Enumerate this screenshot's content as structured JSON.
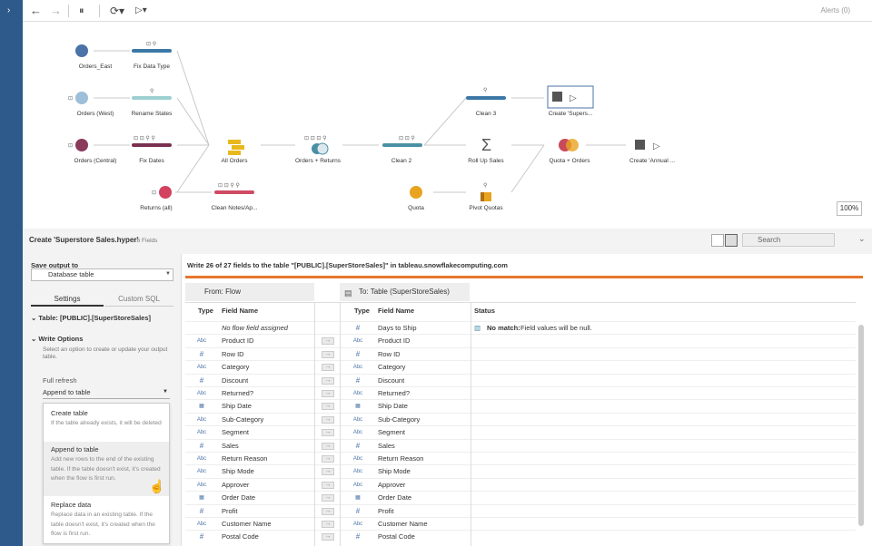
{
  "toolbar": {
    "alerts": "Alerts (0)"
  },
  "nodes": [
    {
      "id": "orders-east",
      "label": "Orders_East"
    },
    {
      "id": "fix-data-type",
      "label": "Fix Data Type"
    },
    {
      "id": "orders-west",
      "label": "Orders (West)"
    },
    {
      "id": "rename-states",
      "label": "Rename States"
    },
    {
      "id": "orders-central",
      "label": "Orders (Central)"
    },
    {
      "id": "fix-dates",
      "label": "Fix Dates"
    },
    {
      "id": "all-orders",
      "label": "All Orders"
    },
    {
      "id": "orders-returns",
      "label": "Orders + Returns"
    },
    {
      "id": "clean-2",
      "label": "Clean 2"
    },
    {
      "id": "returns-all",
      "label": "Returns (all)"
    },
    {
      "id": "clean-notes",
      "label": "Clean Notes/Ap..."
    },
    {
      "id": "clean-3",
      "label": "Clean 3"
    },
    {
      "id": "create-superstore",
      "label": "Create 'Supers..."
    },
    {
      "id": "roll-up-sales",
      "label": "Roll Up Sales"
    },
    {
      "id": "quota-orders",
      "label": "Quota + Orders"
    },
    {
      "id": "create-annual",
      "label": "Create 'Annual ..."
    },
    {
      "id": "quota",
      "label": "Quota"
    },
    {
      "id": "pivot-quotas",
      "label": "Pivot Quotas"
    }
  ],
  "canvas": {
    "zoom": "100%"
  },
  "panel": {
    "title": "Create 'Superstore Sales.hyper'",
    "fields_count": "26 Fields",
    "search_placeholder": "Search"
  },
  "left": {
    "save_output_label": "Save output to",
    "save_output_value": "Database table",
    "tabs": {
      "settings": "Settings",
      "custom_sql": "Custom SQL"
    },
    "table_label": "Table: [PUBLIC].[SuperStoreSales]",
    "write_options_label": "Write Options",
    "write_options_desc": "Select an option to create or update your output table.",
    "full_refresh": "Full refresh",
    "selected": "Append to table",
    "options": [
      {
        "title": "Create table",
        "desc": "If the table already exists, it will be deleted"
      },
      {
        "title": "Append to table",
        "desc": "Add new rows to the end of the existing table. If the table doesn't exist, it's created when the flow is first run."
      },
      {
        "title": "Replace data",
        "desc": "Replace data in an existing table. If the table doesn't exist, it's created when the flow is first run."
      }
    ]
  },
  "right": {
    "write_msg": "Write 26 of 27 fields to the table \"[PUBLIC].[SuperStoreSales]\" in tableau.snowflakecomputing.com",
    "from_header": "From: Flow",
    "to_header": "To: Table (SuperStoreSales)",
    "col_type": "Type",
    "col_field": "Field Name",
    "col_status": "Status",
    "rows": [
      {
        "from_type": "",
        "from": "No flow field assigned",
        "to_type": "#",
        "to": "Days to Ship",
        "status_bold": "No match:",
        "status": "Field values will be null."
      },
      {
        "from_type": "Abc",
        "from": "Product ID",
        "to_type": "Abc",
        "to": "Product ID"
      },
      {
        "from_type": "#",
        "from": "Row ID",
        "to_type": "#",
        "to": "Row ID"
      },
      {
        "from_type": "Abc",
        "from": "Category",
        "to_type": "Abc",
        "to": "Category"
      },
      {
        "from_type": "#",
        "from": "Discount",
        "to_type": "#",
        "to": "Discount"
      },
      {
        "from_type": "Abc",
        "from": "Returned?",
        "to_type": "Abc",
        "to": "Returned?"
      },
      {
        "from_type": "cal",
        "from": "Ship Date",
        "to_type": "cal",
        "to": "Ship Date"
      },
      {
        "from_type": "Abc",
        "from": "Sub-Category",
        "to_type": "Abc",
        "to": "Sub-Category"
      },
      {
        "from_type": "Abc",
        "from": "Segment",
        "to_type": "Abc",
        "to": "Segment"
      },
      {
        "from_type": "#",
        "from": "Sales",
        "to_type": "#",
        "to": "Sales"
      },
      {
        "from_type": "Abc",
        "from": "Return Reason",
        "to_type": "Abc",
        "to": "Return Reason"
      },
      {
        "from_type": "Abc",
        "from": "Ship Mode",
        "to_type": "Abc",
        "to": "Ship Mode"
      },
      {
        "from_type": "Abc",
        "from": "Approver",
        "to_type": "Abc",
        "to": "Approver"
      },
      {
        "from_type": "cal",
        "from": "Order Date",
        "to_type": "cal",
        "to": "Order Date"
      },
      {
        "from_type": "#",
        "from": "Profit",
        "to_type": "#",
        "to": "Profit"
      },
      {
        "from_type": "Abc",
        "from": "Customer Name",
        "to_type": "Abc",
        "to": "Customer Name"
      },
      {
        "from_type": "#",
        "from": "Postal Code",
        "to_type": "#",
        "to": "Postal Code"
      }
    ]
  },
  "colors": {
    "accent": "#e8762d",
    "rail": "#2d5a8a",
    "clean": "#4a90a4"
  }
}
